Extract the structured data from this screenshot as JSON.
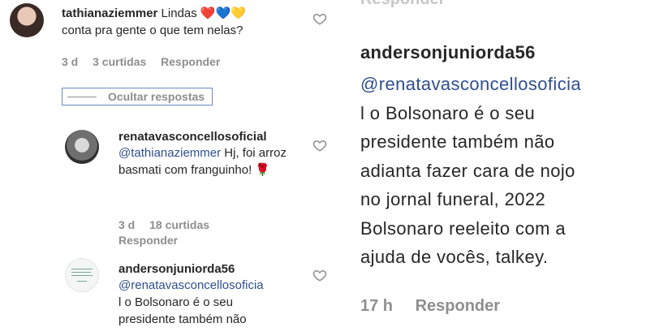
{
  "left": {
    "comment1": {
      "username": "tathianaziemmer",
      "text_before_emoji": "Lindas ",
      "emoji": "❤️💙💛",
      "text_line2": "conta pra gente o que tem nelas?",
      "time": "3 d",
      "likes": "3 curtidas",
      "reply": "Responder"
    },
    "hide_replies": "Ocultar respostas",
    "reply1": {
      "username": "renatavasconcellosoficial",
      "mention": "@tathianaziemmer",
      "text": " Hj, foi arroz basmati com franguinho! ",
      "emoji": "🌹",
      "time": "3 d",
      "likes": "18 curtidas",
      "reply": "Responder"
    },
    "reply2": {
      "username": "andersonjuniorda56",
      "mention": "@renatavasconcellosoficia",
      "text_lines": [
        "l o Bolsonaro é o seu",
        "presidente também não"
      ]
    }
  },
  "right": {
    "top_cut": "Responder",
    "username": "andersonjuniorda56",
    "mention": "@renatavasconcellosoficia",
    "body_lines": [
      "l o Bolsonaro é o seu",
      "presidente também não",
      "adianta fazer cara de nojo",
      "no jornal funeral, 2022",
      "Bolsonaro reeleito com a",
      "ajuda de vocês, talkey."
    ],
    "time": "17 h",
    "reply": "Responder"
  },
  "colors": {
    "mention": "#2f4f8f",
    "meta": "#8e8e8e",
    "text": "#262626"
  }
}
